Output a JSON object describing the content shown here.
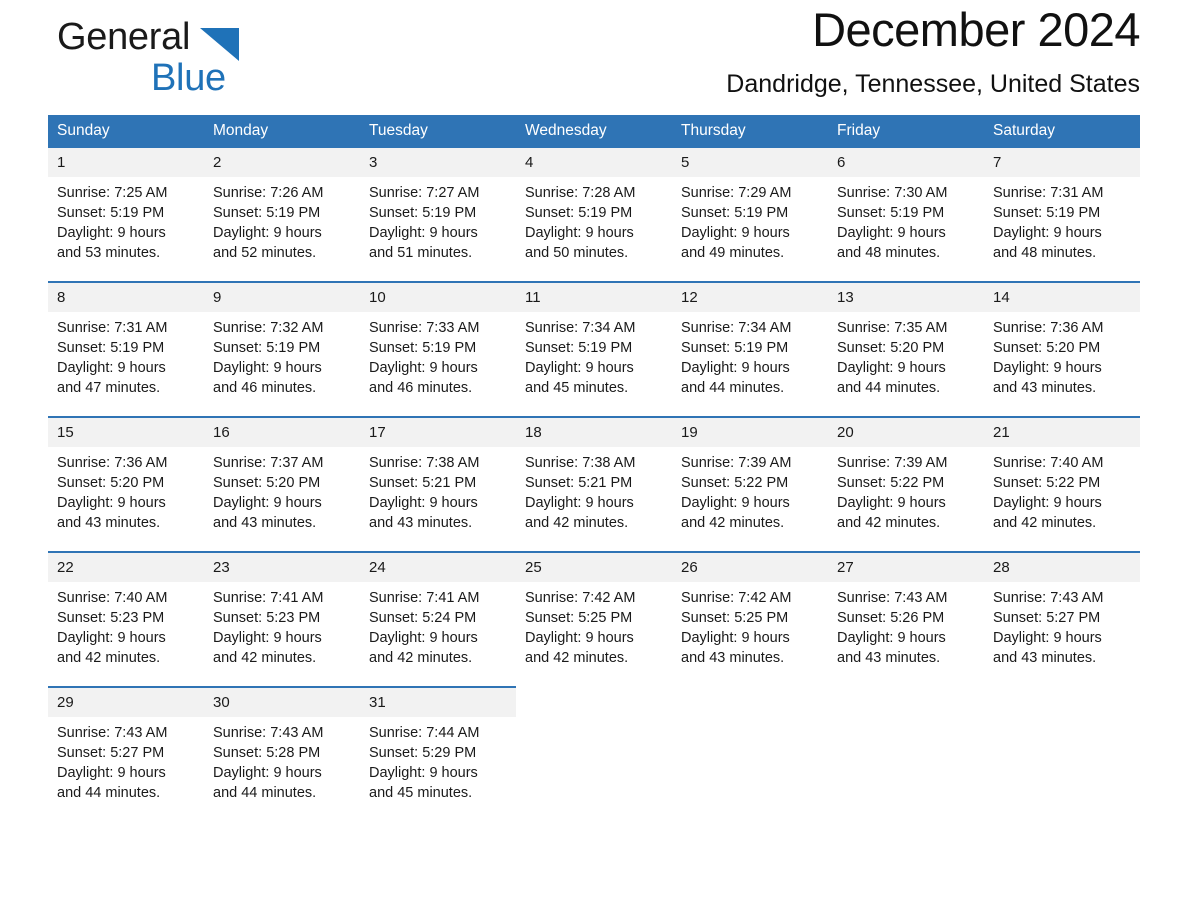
{
  "brand": {
    "name_part1": "General",
    "name_part2": "Blue",
    "triangle_icon": "brand-triangle-icon",
    "accent_color": "#1f72b8"
  },
  "header": {
    "month_title": "December 2024",
    "location": "Dandridge, Tennessee, United States"
  },
  "calendar": {
    "header_bg": "#2f74b5",
    "daynum_bg": "#f2f2f2",
    "weekdays": [
      "Sunday",
      "Monday",
      "Tuesday",
      "Wednesday",
      "Thursday",
      "Friday",
      "Saturday"
    ],
    "weeks": [
      [
        {
          "day": "1",
          "sunrise": "Sunrise: 7:25 AM",
          "sunset": "Sunset: 5:19 PM",
          "daylight": "Daylight: 9 hours\nand 53 minutes."
        },
        {
          "day": "2",
          "sunrise": "Sunrise: 7:26 AM",
          "sunset": "Sunset: 5:19 PM",
          "daylight": "Daylight: 9 hours\nand 52 minutes."
        },
        {
          "day": "3",
          "sunrise": "Sunrise: 7:27 AM",
          "sunset": "Sunset: 5:19 PM",
          "daylight": "Daylight: 9 hours\nand 51 minutes."
        },
        {
          "day": "4",
          "sunrise": "Sunrise: 7:28 AM",
          "sunset": "Sunset: 5:19 PM",
          "daylight": "Daylight: 9 hours\nand 50 minutes."
        },
        {
          "day": "5",
          "sunrise": "Sunrise: 7:29 AM",
          "sunset": "Sunset: 5:19 PM",
          "daylight": "Daylight: 9 hours\nand 49 minutes."
        },
        {
          "day": "6",
          "sunrise": "Sunrise: 7:30 AM",
          "sunset": "Sunset: 5:19 PM",
          "daylight": "Daylight: 9 hours\nand 48 minutes."
        },
        {
          "day": "7",
          "sunrise": "Sunrise: 7:31 AM",
          "sunset": "Sunset: 5:19 PM",
          "daylight": "Daylight: 9 hours\nand 48 minutes."
        }
      ],
      [
        {
          "day": "8",
          "sunrise": "Sunrise: 7:31 AM",
          "sunset": "Sunset: 5:19 PM",
          "daylight": "Daylight: 9 hours\nand 47 minutes."
        },
        {
          "day": "9",
          "sunrise": "Sunrise: 7:32 AM",
          "sunset": "Sunset: 5:19 PM",
          "daylight": "Daylight: 9 hours\nand 46 minutes."
        },
        {
          "day": "10",
          "sunrise": "Sunrise: 7:33 AM",
          "sunset": "Sunset: 5:19 PM",
          "daylight": "Daylight: 9 hours\nand 46 minutes."
        },
        {
          "day": "11",
          "sunrise": "Sunrise: 7:34 AM",
          "sunset": "Sunset: 5:19 PM",
          "daylight": "Daylight: 9 hours\nand 45 minutes."
        },
        {
          "day": "12",
          "sunrise": "Sunrise: 7:34 AM",
          "sunset": "Sunset: 5:19 PM",
          "daylight": "Daylight: 9 hours\nand 44 minutes."
        },
        {
          "day": "13",
          "sunrise": "Sunrise: 7:35 AM",
          "sunset": "Sunset: 5:20 PM",
          "daylight": "Daylight: 9 hours\nand 44 minutes."
        },
        {
          "day": "14",
          "sunrise": "Sunrise: 7:36 AM",
          "sunset": "Sunset: 5:20 PM",
          "daylight": "Daylight: 9 hours\nand 43 minutes."
        }
      ],
      [
        {
          "day": "15",
          "sunrise": "Sunrise: 7:36 AM",
          "sunset": "Sunset: 5:20 PM",
          "daylight": "Daylight: 9 hours\nand 43 minutes."
        },
        {
          "day": "16",
          "sunrise": "Sunrise: 7:37 AM",
          "sunset": "Sunset: 5:20 PM",
          "daylight": "Daylight: 9 hours\nand 43 minutes."
        },
        {
          "day": "17",
          "sunrise": "Sunrise: 7:38 AM",
          "sunset": "Sunset: 5:21 PM",
          "daylight": "Daylight: 9 hours\nand 43 minutes."
        },
        {
          "day": "18",
          "sunrise": "Sunrise: 7:38 AM",
          "sunset": "Sunset: 5:21 PM",
          "daylight": "Daylight: 9 hours\nand 42 minutes."
        },
        {
          "day": "19",
          "sunrise": "Sunrise: 7:39 AM",
          "sunset": "Sunset: 5:22 PM",
          "daylight": "Daylight: 9 hours\nand 42 minutes."
        },
        {
          "day": "20",
          "sunrise": "Sunrise: 7:39 AM",
          "sunset": "Sunset: 5:22 PM",
          "daylight": "Daylight: 9 hours\nand 42 minutes."
        },
        {
          "day": "21",
          "sunrise": "Sunrise: 7:40 AM",
          "sunset": "Sunset: 5:22 PM",
          "daylight": "Daylight: 9 hours\nand 42 minutes."
        }
      ],
      [
        {
          "day": "22",
          "sunrise": "Sunrise: 7:40 AM",
          "sunset": "Sunset: 5:23 PM",
          "daylight": "Daylight: 9 hours\nand 42 minutes."
        },
        {
          "day": "23",
          "sunrise": "Sunrise: 7:41 AM",
          "sunset": "Sunset: 5:23 PM",
          "daylight": "Daylight: 9 hours\nand 42 minutes."
        },
        {
          "day": "24",
          "sunrise": "Sunrise: 7:41 AM",
          "sunset": "Sunset: 5:24 PM",
          "daylight": "Daylight: 9 hours\nand 42 minutes."
        },
        {
          "day": "25",
          "sunrise": "Sunrise: 7:42 AM",
          "sunset": "Sunset: 5:25 PM",
          "daylight": "Daylight: 9 hours\nand 42 minutes."
        },
        {
          "day": "26",
          "sunrise": "Sunrise: 7:42 AM",
          "sunset": "Sunset: 5:25 PM",
          "daylight": "Daylight: 9 hours\nand 43 minutes."
        },
        {
          "day": "27",
          "sunrise": "Sunrise: 7:43 AM",
          "sunset": "Sunset: 5:26 PM",
          "daylight": "Daylight: 9 hours\nand 43 minutes."
        },
        {
          "day": "28",
          "sunrise": "Sunrise: 7:43 AM",
          "sunset": "Sunset: 5:27 PM",
          "daylight": "Daylight: 9 hours\nand 43 minutes."
        }
      ],
      [
        {
          "day": "29",
          "sunrise": "Sunrise: 7:43 AM",
          "sunset": "Sunset: 5:27 PM",
          "daylight": "Daylight: 9 hours\nand 44 minutes."
        },
        {
          "day": "30",
          "sunrise": "Sunrise: 7:43 AM",
          "sunset": "Sunset: 5:28 PM",
          "daylight": "Daylight: 9 hours\nand 44 minutes."
        },
        {
          "day": "31",
          "sunrise": "Sunrise: 7:44 AM",
          "sunset": "Sunset: 5:29 PM",
          "daylight": "Daylight: 9 hours\nand 45 minutes."
        },
        {
          "day": "",
          "sunrise": "",
          "sunset": "",
          "daylight": ""
        },
        {
          "day": "",
          "sunrise": "",
          "sunset": "",
          "daylight": ""
        },
        {
          "day": "",
          "sunrise": "",
          "sunset": "",
          "daylight": ""
        },
        {
          "day": "",
          "sunrise": "",
          "sunset": "",
          "daylight": ""
        }
      ]
    ]
  }
}
